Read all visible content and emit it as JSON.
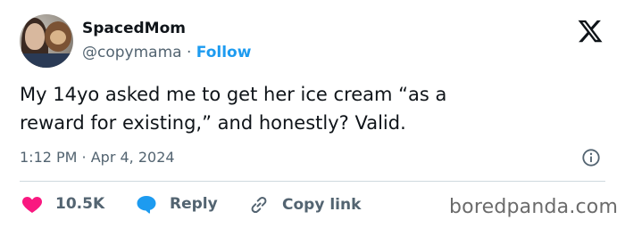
{
  "user": {
    "display_name": "SpacedMom",
    "handle": "@copymama",
    "separator": "·",
    "follow_label": "Follow"
  },
  "tweet": {
    "text_line1": "My 14yo asked me to get her ice cream “as a",
    "text_line2": "reward for existing,” and honestly? Valid.",
    "timestamp": "1:12 PM · Apr 4, 2024"
  },
  "actions": {
    "likes": "10.5K",
    "reply_label": "Reply",
    "copy_link_label": "Copy link"
  },
  "watermark": "boredpanda.com",
  "icons": {
    "brand": "x-logo-icon",
    "info": "info-icon",
    "like": "heart-icon",
    "reply": "reply-bubble-icon",
    "copy": "link-icon"
  },
  "colors": {
    "follow": "#1d9bf0",
    "like": "#f91880",
    "reply": "#1d9bf0",
    "secondary_text": "#536471"
  }
}
